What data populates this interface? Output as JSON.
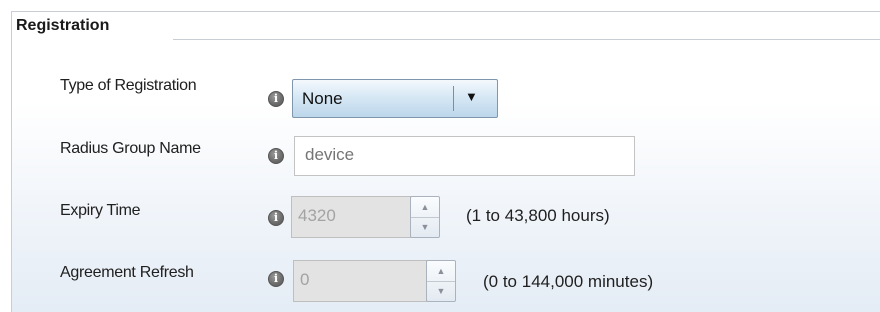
{
  "section": {
    "title": "Registration"
  },
  "fields": {
    "registration_type": {
      "label": "Type of Registration",
      "value": "None",
      "dropdown_icon": "triangle-down"
    },
    "radius_group": {
      "label": "Radius Group Name",
      "placeholder": "device"
    },
    "expiry_time": {
      "label": "Expiry Time",
      "value": "4320",
      "hint": "(1 to 43,800 hours)"
    },
    "agreement_refresh": {
      "label": "Agreement Refresh",
      "value": "0",
      "hint": "(0 to 144,000 minutes)"
    }
  },
  "icons": {
    "info": "info-icon",
    "spin_up": "arrow-up-icon",
    "spin_down": "arrow-down-icon"
  },
  "colors": {
    "select_gradient_top": "#f4f9fd",
    "select_gradient_bottom": "#bcd6ea",
    "disabled_field_bg": "#e3e3e3",
    "panel_gradient_bottom": "#e4ecf5"
  }
}
